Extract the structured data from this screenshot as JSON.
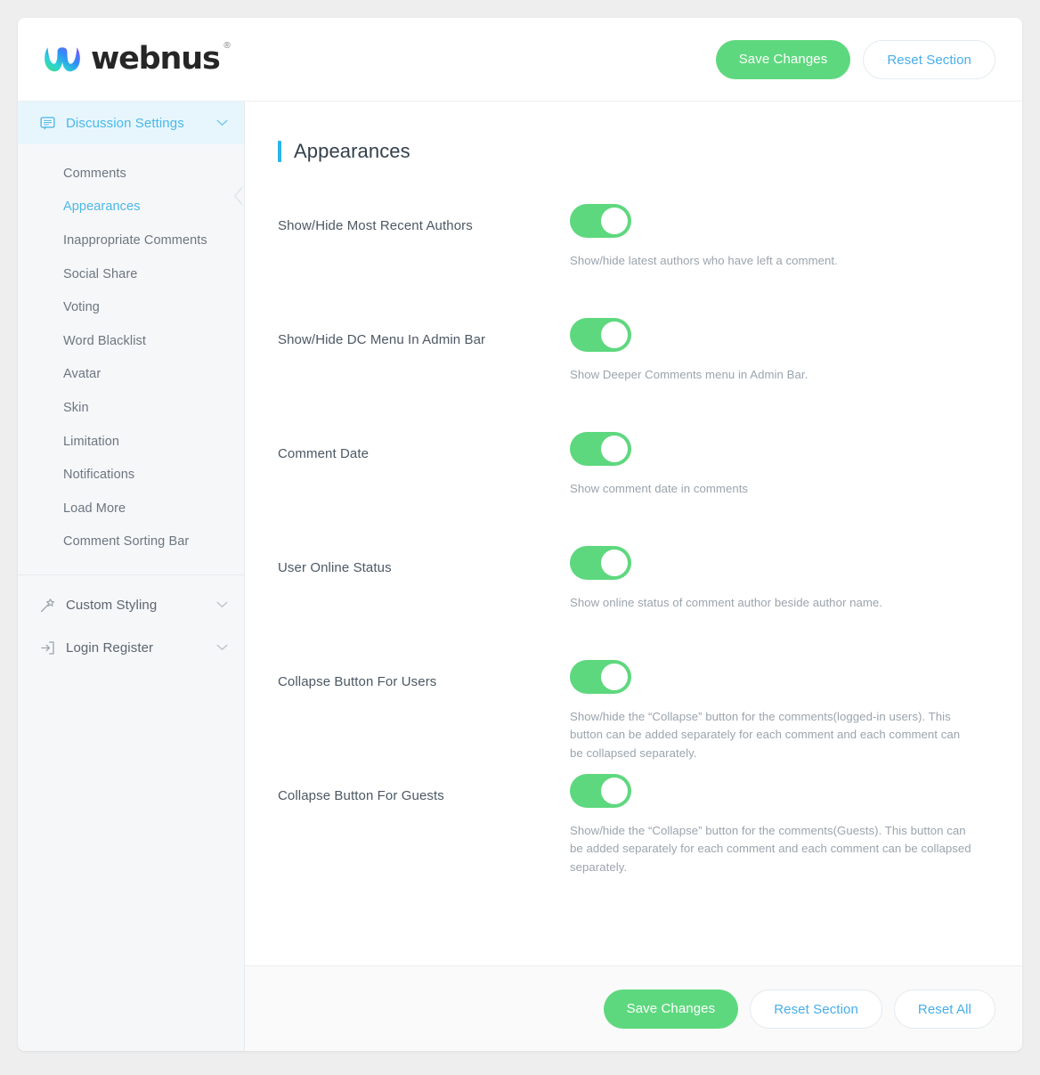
{
  "header": {
    "logo_text": "webnus",
    "logo_registered": "®",
    "save_label": "Save Changes",
    "reset_section_label": "Reset Section"
  },
  "sidebar": {
    "groups": [
      {
        "label": "Discussion Settings",
        "icon": "comment-icon",
        "active": true,
        "items": [
          {
            "label": "Comments",
            "active": false
          },
          {
            "label": "Appearances",
            "active": true
          },
          {
            "label": "Inappropriate Comments",
            "active": false
          },
          {
            "label": "Social Share",
            "active": false
          },
          {
            "label": "Voting",
            "active": false
          },
          {
            "label": "Word Blacklist",
            "active": false
          },
          {
            "label": "Avatar",
            "active": false
          },
          {
            "label": "Skin",
            "active": false
          },
          {
            "label": "Limitation",
            "active": false
          },
          {
            "label": "Notifications",
            "active": false
          },
          {
            "label": "Load More",
            "active": false
          },
          {
            "label": "Comment Sorting Bar",
            "active": false
          }
        ]
      },
      {
        "label": "Custom Styling",
        "icon": "magic-wand-icon",
        "active": false
      },
      {
        "label": "Login Register",
        "icon": "sign-in-icon",
        "active": false
      }
    ]
  },
  "main": {
    "title": "Appearances",
    "settings": [
      {
        "label": "Show/Hide Most Recent Authors",
        "toggle_state": "on",
        "description": "Show/hide latest authors who have left a comment."
      },
      {
        "label": "Show/Hide DC Menu In Admin Bar",
        "toggle_state": "on",
        "description": "Show Deeper Comments menu in Admin Bar."
      },
      {
        "label": "Comment Date",
        "toggle_state": "on",
        "description": "Show comment date in comments"
      },
      {
        "label": "User Online Status",
        "toggle_state": "on",
        "description": "Show online status of comment author beside author name."
      },
      {
        "label": "Collapse Button For Users",
        "toggle_state": "on",
        "description": "Show/hide the “Collapse” button for the comments(logged-in users). This button can be added separately for each comment and each comment can be collapsed separately."
      },
      {
        "label": "Collapse Button For Guests",
        "toggle_state": "on",
        "description": "Show/hide the “Collapse” button for the comments(Guests). This button can be added separately for each comment and each comment can be collapsed separately."
      }
    ]
  },
  "footer": {
    "save_label": "Save Changes",
    "reset_section_label": "Reset Section",
    "reset_all_label": "Reset All"
  },
  "colors": {
    "accent_blue": "#29b6e8",
    "link_blue": "#47aeea",
    "toggle_green": "#5ed87e",
    "sidebar_bg": "#f6f7f9",
    "active_item_bg": "#e7f6fd"
  }
}
